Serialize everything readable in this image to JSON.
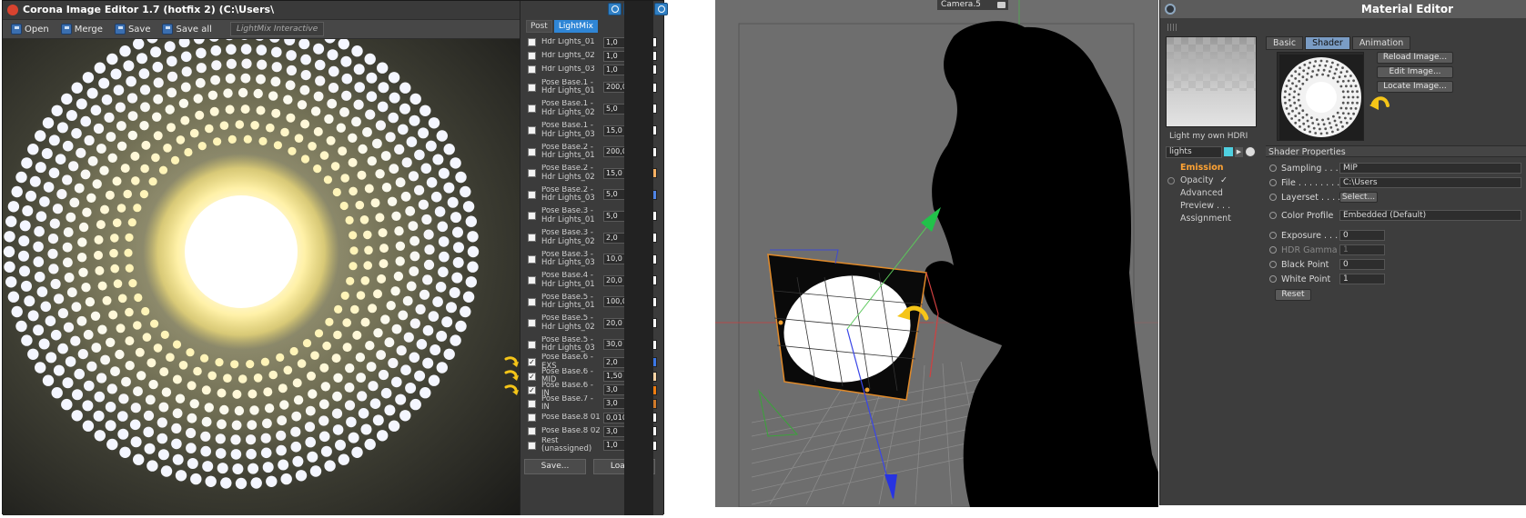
{
  "corona": {
    "title": "Corona Image Editor 1.7 (hotfix 2) (C:\\Users\\",
    "toolbar": {
      "open": "Open",
      "merge": "Merge",
      "save": "Save",
      "save_all": "Save all",
      "mode": "LightMix Interactive"
    },
    "tabs": {
      "post": "Post",
      "lightmix": "LightMix"
    },
    "lightmix": [
      {
        "name": "Hdr Lights_01",
        "value": "1,0",
        "color": "#ffffff",
        "checked": false
      },
      {
        "name": "Hdr Lights_02",
        "value": "1,0",
        "color": "#ffffff",
        "checked": false
      },
      {
        "name": "Hdr Lights_03",
        "value": "1,0",
        "color": "#ffffff",
        "checked": false
      },
      {
        "name": "Pose Base.1 - Hdr Lights_01",
        "value": "200,0",
        "color": "#ffffff",
        "checked": false
      },
      {
        "name": "Pose Base.1 - Hdr Lights_02",
        "value": "5,0",
        "color": "#ffffff",
        "checked": false
      },
      {
        "name": "Pose Base.1 - Hdr Lights_03",
        "value": "15,0",
        "color": "#ffffff",
        "checked": false
      },
      {
        "name": "Pose Base.2 - Hdr Lights_01",
        "value": "200,0",
        "color": "#ffffff",
        "checked": false
      },
      {
        "name": "Pose Base.2 - Hdr Lights_02",
        "value": "15,0",
        "color": "#f6b062",
        "checked": false
      },
      {
        "name": "Pose Base.2 - Hdr Lights_03",
        "value": "5,0",
        "color": "#4f84e6",
        "checked": false
      },
      {
        "name": "Pose Base.3 - Hdr Lights_01",
        "value": "5,0",
        "color": "#ffffff",
        "checked": false
      },
      {
        "name": "Pose Base.3 - Hdr Lights_02",
        "value": "2,0",
        "color": "#ffffff",
        "checked": false
      },
      {
        "name": "Pose Base.3 - Hdr Lights_03",
        "value": "10,0",
        "color": "#ffffff",
        "checked": false
      },
      {
        "name": "Pose Base.4 - Hdr Lights_01",
        "value": "20,0",
        "color": "#ffffff",
        "checked": false
      },
      {
        "name": "Pose Base.5 - Hdr Lights_01",
        "value": "100,0",
        "color": "#ffffff",
        "checked": false
      },
      {
        "name": "Pose Base.5 - Hdr Lights_02",
        "value": "20,0",
        "color": "#ffffff",
        "checked": false
      },
      {
        "name": "Pose Base.5 - Hdr Lights_03",
        "value": "30,0",
        "color": "#ffffff",
        "checked": false
      },
      {
        "name": "Pose Base.6 - EXS",
        "value": "2,0",
        "color": "#3c78e6",
        "checked": true
      },
      {
        "name": "Pose Base.6 - MID",
        "value": "1,50",
        "color": "#f8d4a4",
        "checked": true
      },
      {
        "name": "Pose Base.6 - IN",
        "value": "3,0",
        "color": "#ef7d10",
        "checked": true
      },
      {
        "name": "Pose Base.7 - IN",
        "value": "3,0",
        "color": "#d07a2a",
        "checked": false
      },
      {
        "name": "Pose Base.8 01",
        "value": "0,010",
        "color": "#ffffff",
        "checked": false
      },
      {
        "name": "Pose Base.8 02",
        "value": "3,0",
        "color": "#ffffff",
        "checked": false
      },
      {
        "name": "Rest (unassigned)",
        "value": "1,0",
        "color": "#ffffff",
        "checked": false
      }
    ],
    "buttons": {
      "save": "Save...",
      "load": "Load..."
    }
  },
  "viewport": {
    "camera": "Camera.5"
  },
  "material_editor": {
    "title": "Material Editor",
    "material_name": "Light my own HDRI",
    "filter": "lights",
    "channels": [
      {
        "label": "Emission",
        "active": true
      },
      {
        "label": "Opacity",
        "active": false,
        "checked": true
      },
      {
        "label": "Advanced",
        "active": false
      },
      {
        "label": "Preview . . .",
        "active": false
      },
      {
        "label": "Assignment",
        "active": false
      }
    ],
    "tabs": [
      "Basic",
      "Shader",
      "Animation"
    ],
    "image_buttons": [
      "Reload Image...",
      "Edit Image...",
      "Locate Image..."
    ],
    "shader_properties_title": "Shader Properties",
    "properties": {
      "sampling_label": "Sampling . . .",
      "sampling_value": "MIP",
      "file_label": "File . . . . . . . .",
      "file_value": "C:\\Users",
      "layerset_label": "Layerset . . . .",
      "layerset_button": "Select...",
      "color_profile_label": "Color Profile",
      "color_profile_value": "Embedded (Default)",
      "exposure_label": "Exposure . . .",
      "exposure_value": "0",
      "hdr_gamma_label": "HDR Gamma",
      "hdr_gamma_value": "1",
      "black_point_label": "Black Point",
      "black_point_value": "0",
      "white_point_label": "White Point",
      "white_point_value": "1"
    },
    "reset": "Reset"
  },
  "colors": {
    "accent": "#2f86d6",
    "highlight": "#ffa333",
    "arrow": "#f5c518"
  }
}
